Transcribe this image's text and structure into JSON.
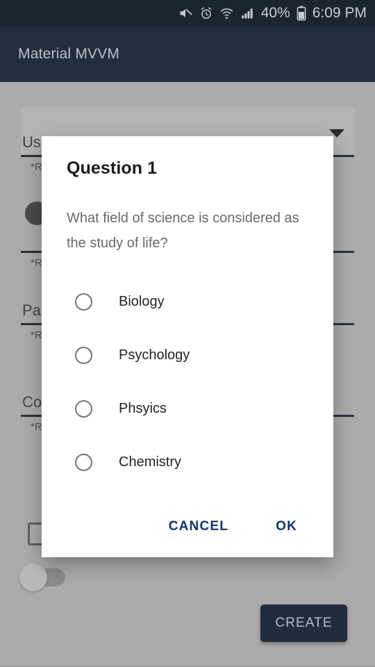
{
  "status_bar": {
    "icons": [
      "mute-icon",
      "alarm-icon",
      "wifi-icon",
      "signal-icon"
    ],
    "battery_percent": "40%",
    "battery_icon": "battery-icon",
    "time": "6:09 PM",
    "background_color": "#1b2532",
    "text_color": "#c7ccd3"
  },
  "toolbar": {
    "title": "Material MVVM",
    "background_color": "#222d3d",
    "text_color": "#bcc1c7"
  },
  "background_form": {
    "username_field": {
      "value": "Username",
      "helper": "*Required",
      "dropdown_icon": "chevron-down-icon"
    },
    "email_field": {
      "value": "",
      "helper": "*Required"
    },
    "password_field": {
      "value": "Password",
      "helper": "*Required"
    },
    "confirm_field": {
      "value": "Confirm Password",
      "helper": "*Required"
    },
    "terms_checkbox": {
      "label": "",
      "checked": false
    },
    "notify_switch": {
      "label": "",
      "checked": false
    },
    "create_button": {
      "label": "CREATE",
      "background_color": "#202d3d",
      "text_color": "#b9bdc2"
    },
    "scrim_color": "#ababab"
  },
  "dialog": {
    "title": "Question 1",
    "message": "What field of science is considered as the study of life?",
    "background_color": "#ffffff",
    "title_color": "#1c1c1c",
    "message_color": "#686868",
    "accent_color": "#10356b",
    "options": [
      {
        "label": "Biology",
        "selected": false
      },
      {
        "label": "Psychology",
        "selected": false
      },
      {
        "label": "Phsyics",
        "selected": false
      },
      {
        "label": "Chemistry",
        "selected": false
      }
    ],
    "cancel_label": "CANCEL",
    "ok_label": "OK"
  }
}
